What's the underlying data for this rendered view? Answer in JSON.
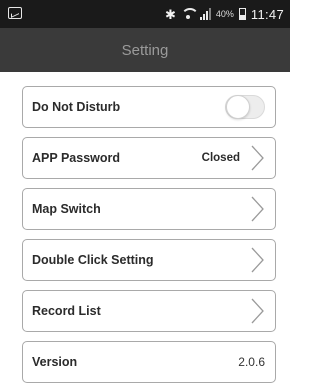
{
  "status_bar": {
    "battery": "40%",
    "time": "11:47"
  },
  "header": {
    "title": "Setting"
  },
  "settings": {
    "do_not_disturb": {
      "label": "Do Not Disturb",
      "enabled": false
    },
    "app_password": {
      "label": "APP Password",
      "value": "Closed"
    },
    "map_switch": {
      "label": "Map Switch"
    },
    "double_click": {
      "label": "Double Click Setting"
    },
    "record_list": {
      "label": "Record List"
    },
    "version": {
      "label": "Version",
      "value": "2.0.6"
    }
  },
  "icons": {
    "status_left": "image-notification-icon",
    "bluetooth": "bluetooth-icon",
    "wifi": "wifi-icon",
    "signal": "signal-icon",
    "battery": "battery-icon",
    "chevron": "chevron-right-icon"
  },
  "colors": {
    "status_bar_bg": "#1a1a1a",
    "app_bar_bg": "#3a3a3a",
    "title_text": "#9a9a9a",
    "row_border": "#a9a9a9"
  }
}
